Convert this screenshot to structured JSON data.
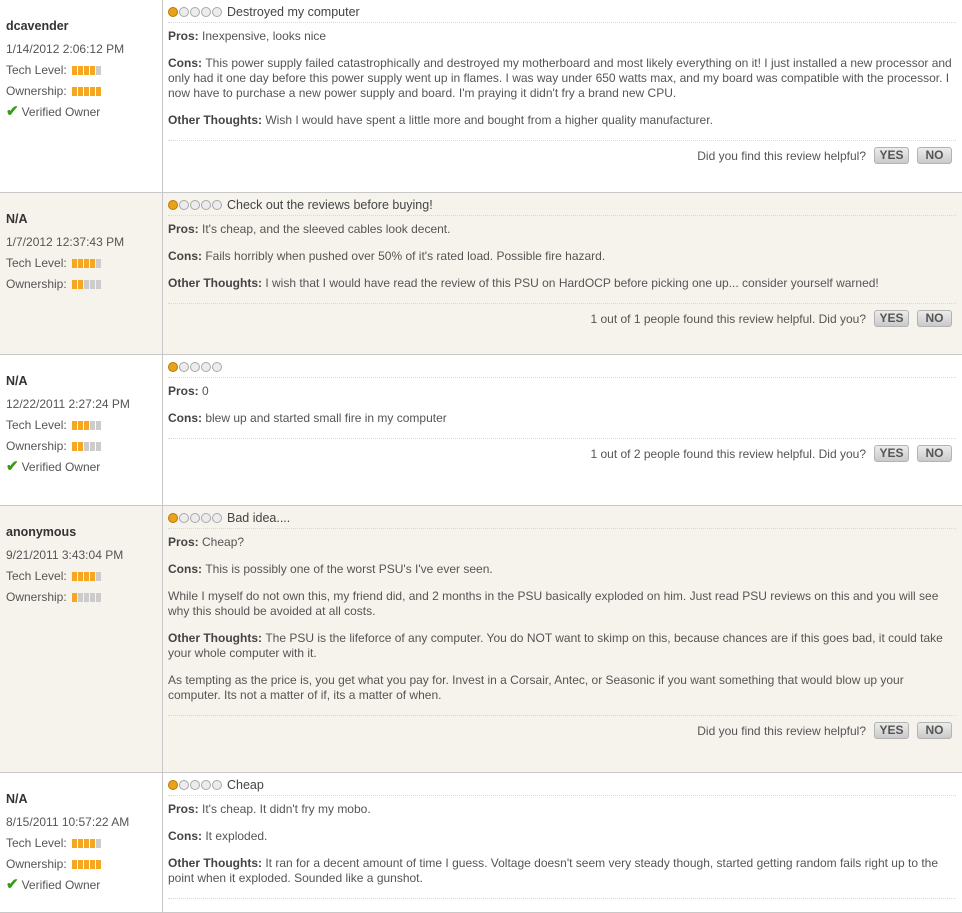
{
  "labels": {
    "tech": "Tech Level:",
    "own": "Ownership:",
    "verified": "Verified Owner",
    "yes": "YES",
    "no": "NO"
  },
  "reviews": [
    {
      "author": "dcavender",
      "date": "1/14/2012 2:06:12 PM",
      "tech": 4,
      "ownership": 5,
      "verified": true,
      "rating": 1,
      "title": "Destroyed my computer",
      "pros": "Inexpensive, looks nice",
      "cons": "This power supply failed catastrophically and destroyed my motherboard and most likely everything on it! I just installed a new processor and only had it one day before this power supply went up in flames. I was way under 650 watts max, and my board was compatible with the processor. I now have to purchase a new power supply and board. I'm praying it didn't fry a brand new CPU.",
      "other": "Wish I would have spent a little more and bought from a higher quality manufacturer.",
      "help": "Did you find this review helpful?"
    },
    {
      "author": "N/A",
      "date": "1/7/2012 12:37:43 PM",
      "tech": 4,
      "ownership": 2,
      "verified": false,
      "rating": 1,
      "title": "Check out the reviews before buying!",
      "pros": "It's cheap, and the sleeved cables look decent.",
      "cons": "Fails horribly when pushed over 50% of it's rated load. Possible fire hazard.",
      "other": "I wish that I would have read the review of this PSU on HardOCP before picking one up... consider yourself warned!",
      "help": "1 out of 1 people found this review helpful. Did you?"
    },
    {
      "author": "N/A",
      "date": "12/22/2011 2:27:24 PM",
      "tech": 3,
      "ownership": 2,
      "verified": true,
      "rating": 1,
      "title": "",
      "pros": "0",
      "cons": "blew up and started small fire in my computer",
      "help": "1 out of 2 people found this review helpful. Did you?"
    },
    {
      "author": "anonymous",
      "date": "9/21/2011 3:43:04 PM",
      "tech": 4,
      "ownership": 1,
      "verified": false,
      "rating": 1,
      "title": "Bad idea....",
      "pros": "Cheap?",
      "cons": "This is possibly one of the worst PSU's I've ever seen.",
      "cons2": "While I myself do not own this, my friend did, and 2 months in the PSU basically exploded on him. Just read PSU reviews on this and you will see why this should be avoided at all costs.",
      "other": "The PSU is the lifeforce of any computer. You do NOT want to skimp on this, because chances are if this goes bad, it could take your whole computer with it.",
      "other2": "As tempting as the price is, you get what you pay for. Invest in a Corsair, Antec, or Seasonic if you want something that would blow up your computer. Its not a matter of if, its a matter of when.",
      "help": "Did you find this review helpful?"
    },
    {
      "author": "N/A",
      "date": "8/15/2011 10:57:22 AM",
      "tech": 4,
      "ownership": 5,
      "verified": true,
      "rating": 1,
      "title": "Cheap",
      "pros": "It's cheap. It didn't fry my mobo.",
      "cons": "It exploded.",
      "other": "It ran for a decent amount of time I guess. Voltage doesn't seem very steady though, started getting random fails right up to the point when it exploded. Sounded like a gunshot.",
      "help": ""
    }
  ]
}
